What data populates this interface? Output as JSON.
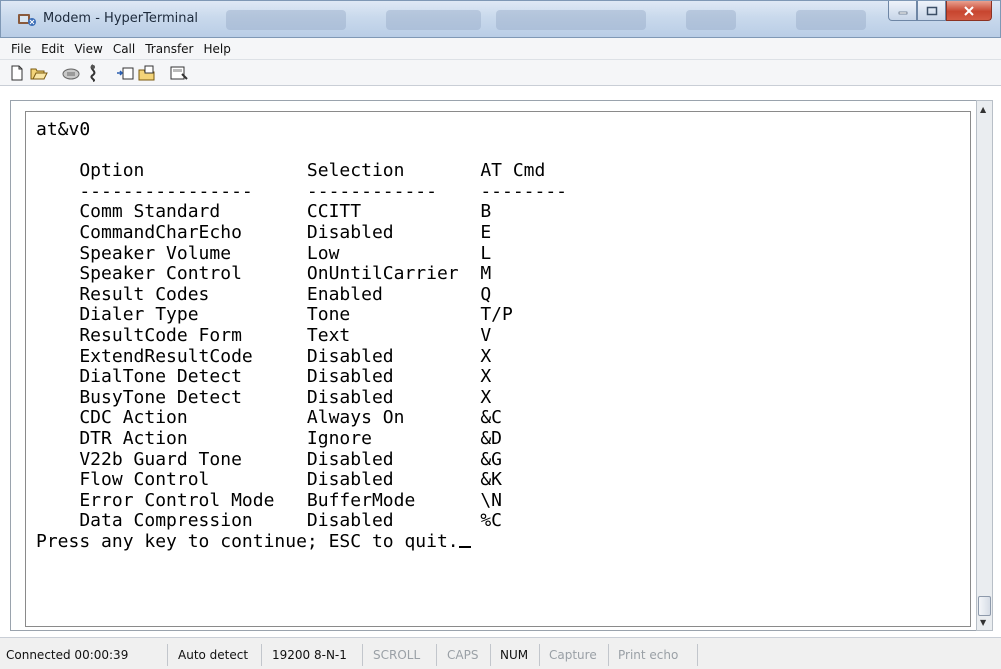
{
  "window": {
    "title": "Modem - HyperTerminal"
  },
  "menu": [
    "File",
    "Edit",
    "View",
    "Call",
    "Transfer",
    "Help"
  ],
  "toolbar": {
    "icons": [
      "new-file-icon",
      "open-folder-icon",
      "call-icon",
      "disconnect-icon",
      "send-icon",
      "receive-icon",
      "properties-icon"
    ]
  },
  "terminal": {
    "command": "at&v0",
    "header": {
      "option": "Option",
      "selection": "Selection",
      "atcmd": "AT Cmd"
    },
    "dashes": {
      "option": "----------------",
      "selection": "------------",
      "atcmd": "--------"
    },
    "rows": [
      {
        "option": "Comm Standard",
        "selection": "CCITT",
        "atcmd": "B"
      },
      {
        "option": "CommandCharEcho",
        "selection": "Disabled",
        "atcmd": "E"
      },
      {
        "option": "Speaker Volume",
        "selection": "Low",
        "atcmd": "L"
      },
      {
        "option": "Speaker Control",
        "selection": "OnUntilCarrier",
        "atcmd": "M"
      },
      {
        "option": "Result Codes",
        "selection": "Enabled",
        "atcmd": "Q"
      },
      {
        "option": "Dialer Type",
        "selection": "Tone",
        "atcmd": "T/P"
      },
      {
        "option": "ResultCode Form",
        "selection": "Text",
        "atcmd": "V"
      },
      {
        "option": "ExtendResultCode",
        "selection": "Disabled",
        "atcmd": "X"
      },
      {
        "option": "DialTone Detect",
        "selection": "Disabled",
        "atcmd": "X"
      },
      {
        "option": "BusyTone Detect",
        "selection": "Disabled",
        "atcmd": "X"
      },
      {
        "option": "CDC Action",
        "selection": "Always On",
        "atcmd": "&C"
      },
      {
        "option": "DTR Action",
        "selection": "Ignore",
        "atcmd": "&D"
      },
      {
        "option": "V22b Guard Tone",
        "selection": "Disabled",
        "atcmd": "&G"
      },
      {
        "option": "Flow Control",
        "selection": "Disabled",
        "atcmd": "&K"
      },
      {
        "option": "Error Control Mode",
        "selection": "BufferMode",
        "atcmd": "\\N"
      },
      {
        "option": "Data Compression",
        "selection": "Disabled",
        "atcmd": "%C"
      }
    ],
    "prompt": "Press any key to continue; ESC to quit."
  },
  "status": {
    "connected": "Connected 00:00:39",
    "detect": "Auto detect",
    "settings": "19200 8-N-1",
    "scroll": "SCROLL",
    "caps": "CAPS",
    "num": "NUM",
    "capture": "Capture",
    "print_echo": "Print echo"
  }
}
